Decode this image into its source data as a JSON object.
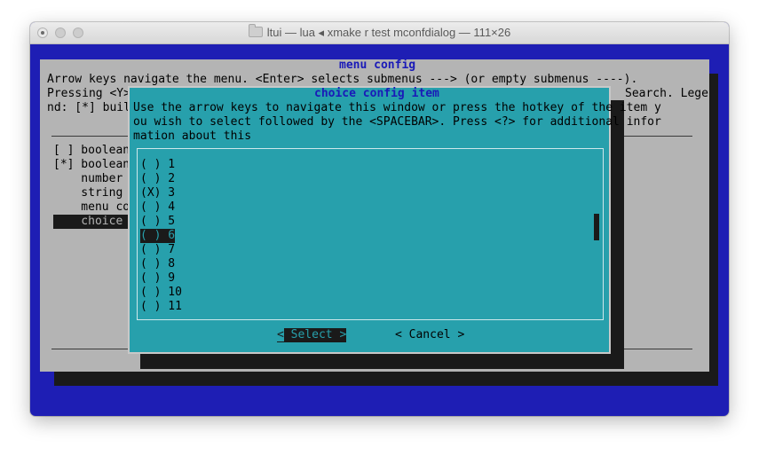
{
  "window": {
    "title": "ltui — lua ◂ xmake r test mconfdialog — 111×26"
  },
  "main_menu": {
    "title": "menu config",
    "help_line1": "Arrow keys navigate the menu. <Enter> selects submenus ---> (or empty submenus ----).",
    "help_line2_left": "Pressing <Y>",
    "help_line2_right": "Search. Lege",
    "help_line3_left": "nd: [*] built",
    "items": [
      {
        "label": "[ ] boolean"
      },
      {
        "label": "[*] boolean"
      },
      {
        "label": "    number c"
      },
      {
        "label": "    string c"
      },
      {
        "label": "    menu con"
      },
      {
        "label": "    choice c"
      }
    ]
  },
  "dialog": {
    "title": "choice config item",
    "help_line1": "Use the arrow keys to navigate this window or press the hotkey of the item y",
    "help_line2": "ou wish to select followed by the <SPACEBAR>. Press <?> for additional infor",
    "help_line3": "mation about this",
    "options": [
      {
        "label": "( ) 1"
      },
      {
        "label": "( ) 2"
      },
      {
        "label": "(X) 3"
      },
      {
        "label": "( ) 4"
      },
      {
        "label": "( ) 5"
      },
      {
        "label": "( ) 6"
      },
      {
        "label": "( ) 7"
      },
      {
        "label": "( ) 8"
      },
      {
        "label": "( ) 9"
      },
      {
        "label": "( ) 10"
      },
      {
        "label": "( ) 11"
      }
    ],
    "select_button": {
      "first": "<",
      "rest": " Select >"
    },
    "cancel_button": "< Cancel >"
  }
}
